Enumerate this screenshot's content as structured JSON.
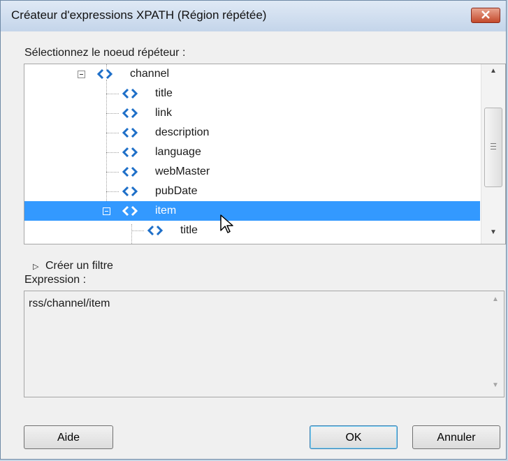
{
  "window": {
    "title": "Créateur d'expressions XPATH (Région répétée)"
  },
  "labels": {
    "select_node": "Sélectionnez le noeud répéteur :",
    "create_filter": "Créer un filtre",
    "expression": "Expression :"
  },
  "tree": {
    "nodes": [
      {
        "label": "channel",
        "toggle": "expanded"
      },
      {
        "label": "title"
      },
      {
        "label": "link"
      },
      {
        "label": "description"
      },
      {
        "label": "language"
      },
      {
        "label": "webMaster"
      },
      {
        "label": "pubDate"
      },
      {
        "label": "item",
        "toggle": "expanded",
        "selected": true
      },
      {
        "label": "title"
      }
    ]
  },
  "expression": {
    "value": "rss/channel/item"
  },
  "buttons": {
    "help": "Aide",
    "ok": "OK",
    "cancel": "Annuler"
  },
  "colors": {
    "selection": "#3399ff",
    "node_icon": "#1e6fc8",
    "close": "#c44a2c"
  }
}
